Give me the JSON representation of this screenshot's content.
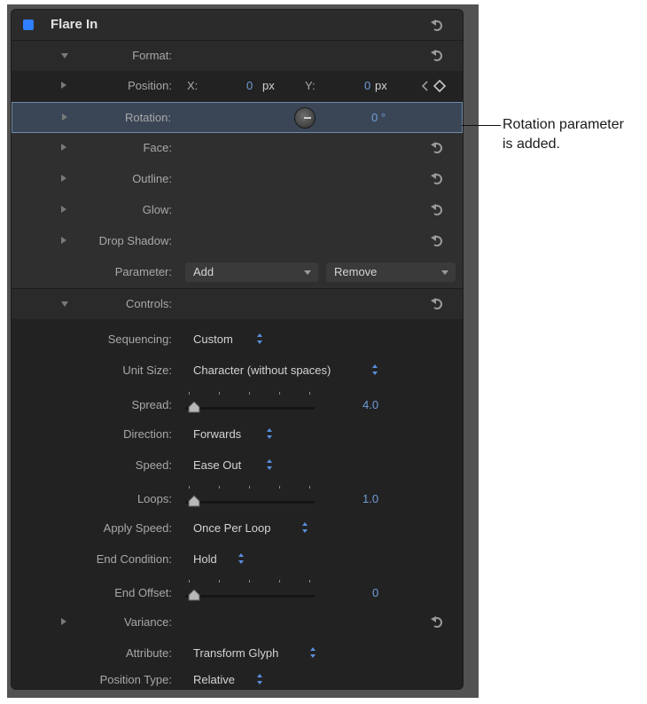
{
  "header": {
    "title": "Flare In"
  },
  "rows": {
    "format": "Format:",
    "position": {
      "label": "Position:",
      "x_label": "X:",
      "x_value": "0",
      "x_unit": "px",
      "y_label": "Y:",
      "y_value": "0",
      "y_unit": "px"
    },
    "rotation": {
      "label": "Rotation:",
      "value": "0 °"
    },
    "face": "Face:",
    "outline": "Outline:",
    "glow": "Glow:",
    "drop_shadow": "Drop Shadow:",
    "parameter": {
      "label": "Parameter:",
      "add": "Add",
      "remove": "Remove"
    },
    "controls": "Controls:",
    "sequencing": {
      "label": "Sequencing:",
      "value": "Custom"
    },
    "unit_size": {
      "label": "Unit Size:",
      "value": "Character (without spaces)"
    },
    "spread": {
      "label": "Spread:",
      "value": "4.0"
    },
    "direction": {
      "label": "Direction:",
      "value": "Forwards"
    },
    "speed": {
      "label": "Speed:",
      "value": "Ease Out"
    },
    "loops": {
      "label": "Loops:",
      "value": "1.0"
    },
    "apply_speed": {
      "label": "Apply Speed:",
      "value": "Once Per Loop"
    },
    "end_condition": {
      "label": "End Condition:",
      "value": "Hold"
    },
    "end_offset": {
      "label": "End Offset:",
      "value": "0"
    },
    "variance": "Variance:",
    "attribute": {
      "label": "Attribute:",
      "value": "Transform Glyph"
    },
    "position_type": {
      "label": "Position Type:",
      "value": "Relative"
    }
  },
  "callout": {
    "line1": "Rotation parameter",
    "line2": "is added."
  },
  "colors": {
    "accent_blue": "#2f7fff",
    "value_blue": "#6f9edb",
    "panel_bg": "#2f2f2f",
    "selected_row": "#3a4656"
  }
}
